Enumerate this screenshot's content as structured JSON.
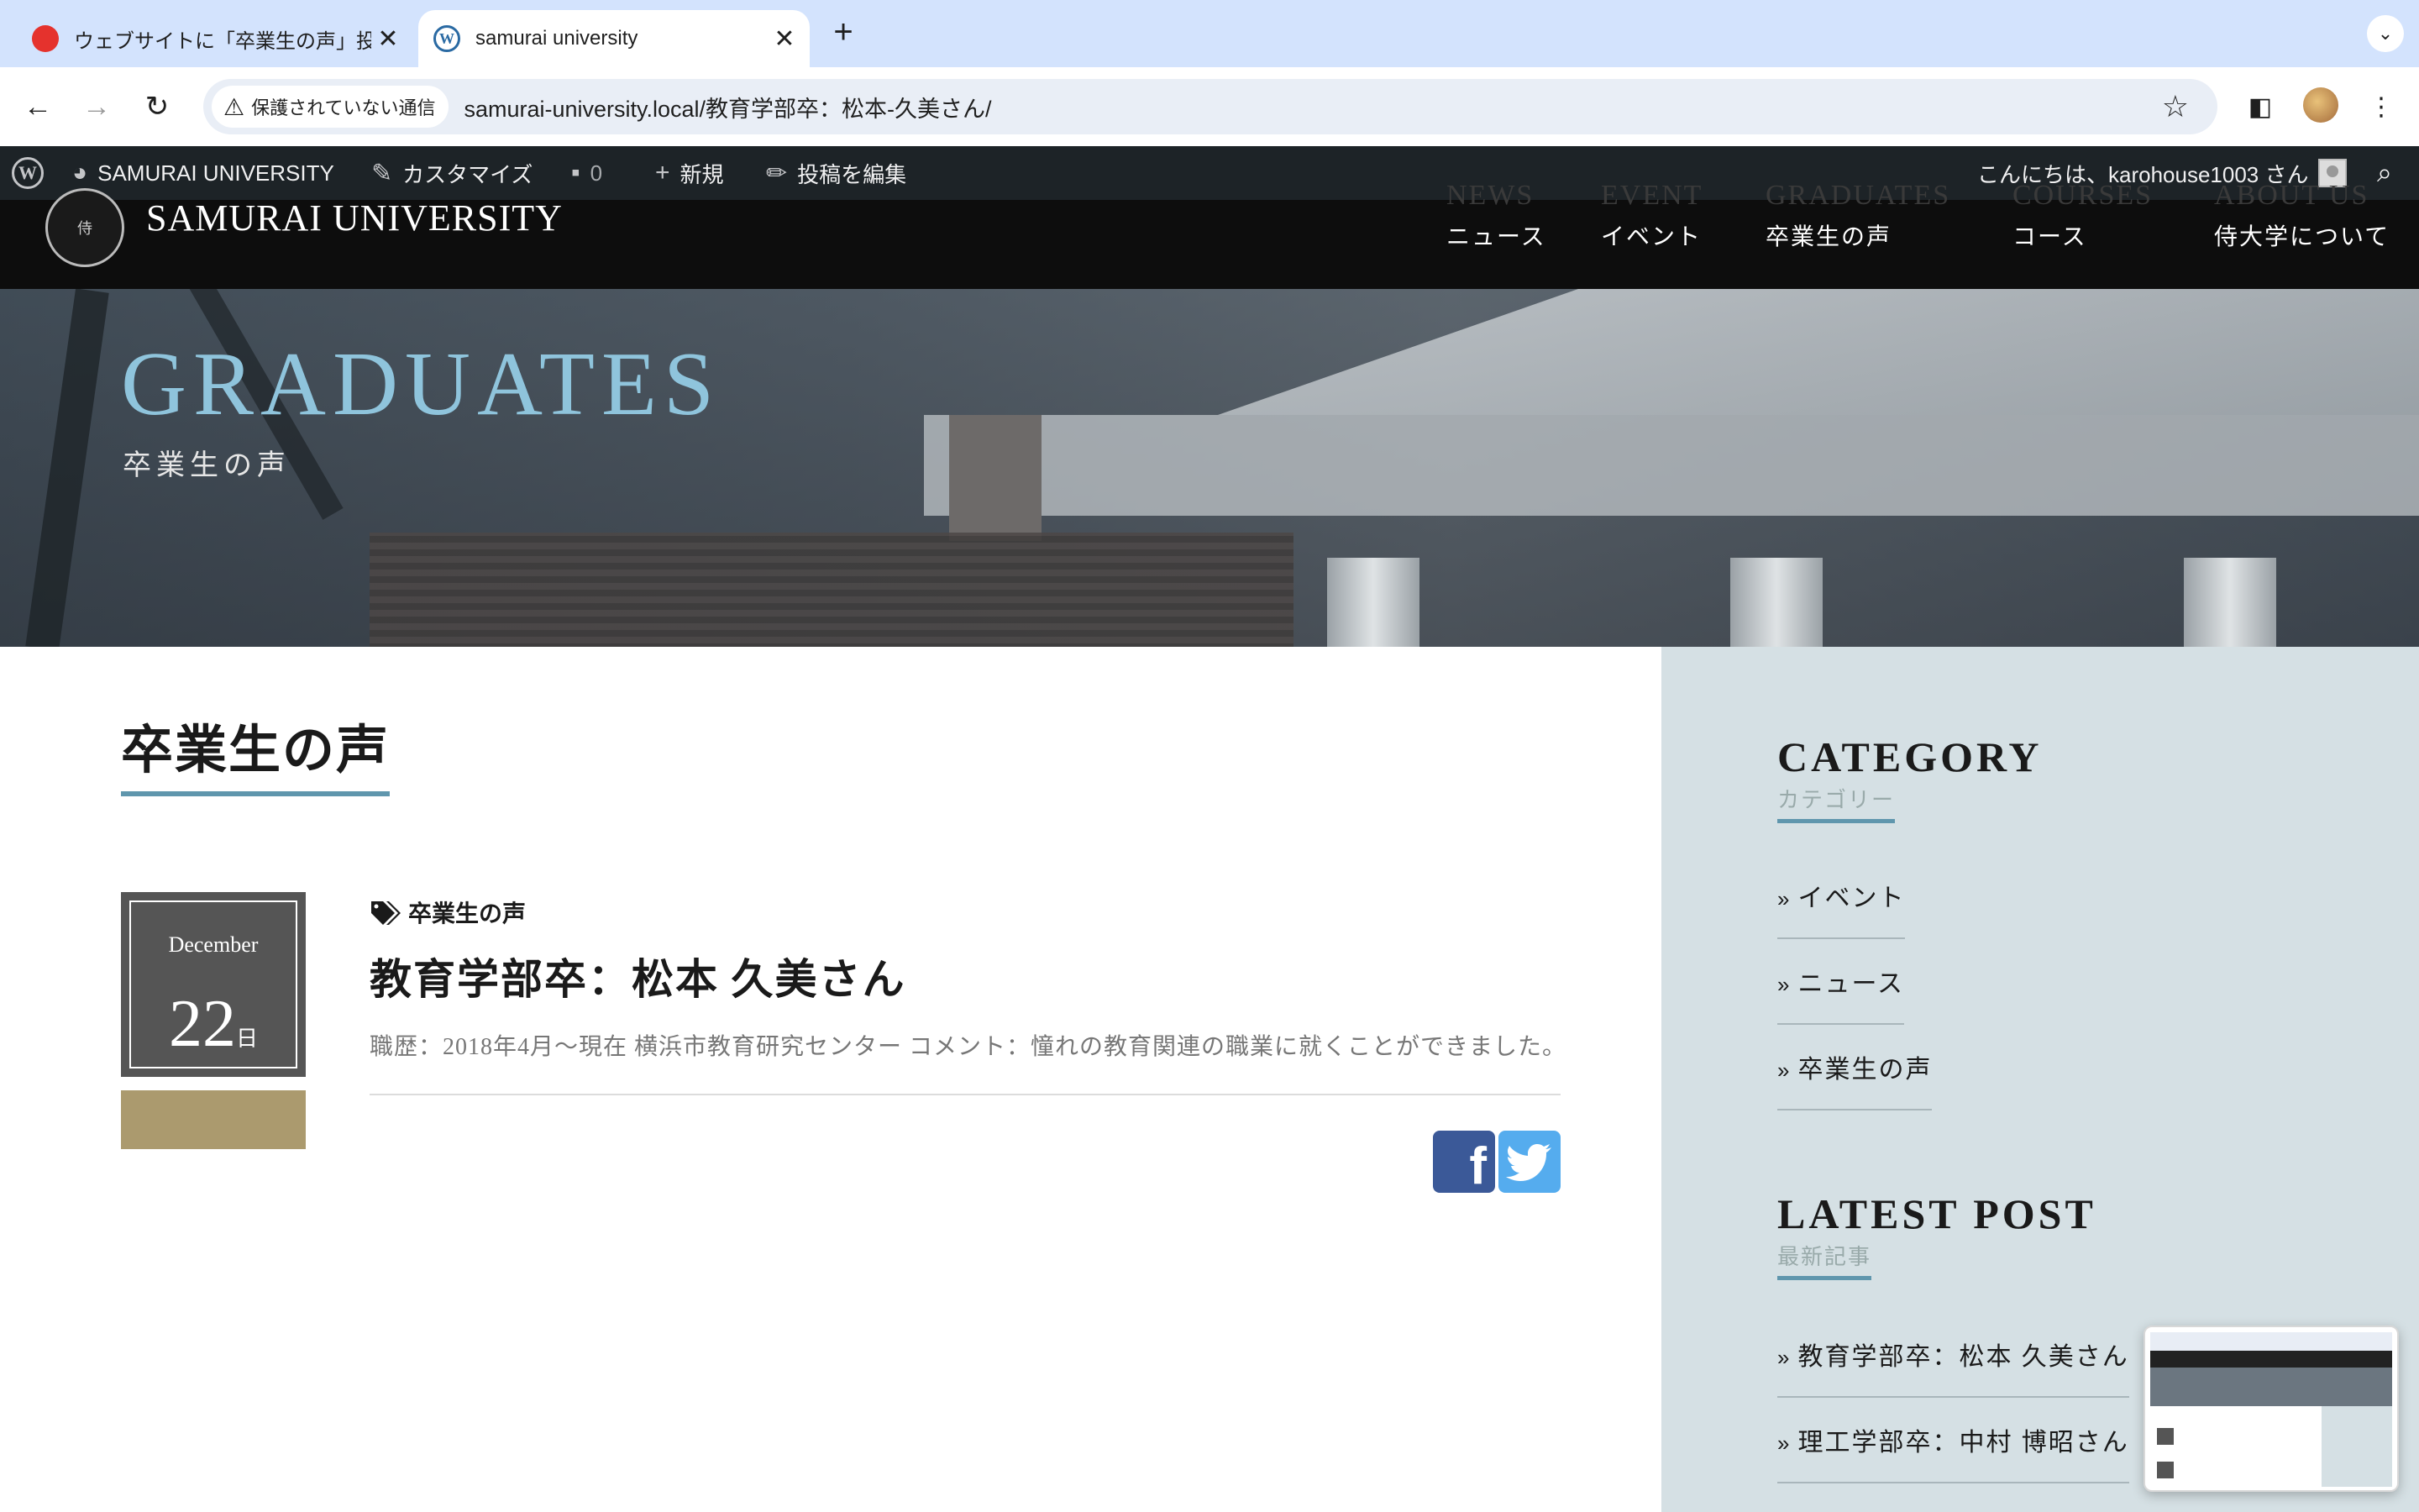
{
  "browser": {
    "tabs": [
      {
        "title": "ウェブサイトに「卒業生の声」投",
        "active": false
      },
      {
        "title": "samurai university",
        "active": true
      }
    ],
    "security_label": "保護されていない通信",
    "url": "samurai-university.local/教育学部卒：松本-久美さん/"
  },
  "adminbar": {
    "site_name": "SAMURAI UNIVERSITY",
    "customize": "カスタマイズ",
    "comments_count": "0",
    "new": "新規",
    "edit_post": "投稿を編集",
    "greeting": "こんにちは、karohouse1003 さん"
  },
  "site": {
    "name": "SAMURAI UNIVERSITY",
    "nav": [
      {
        "en": "NEWS",
        "jp": "ニュース"
      },
      {
        "en": "EVENT",
        "jp": "イベント"
      },
      {
        "en": "GRADUATES",
        "jp": "卒業生の声"
      },
      {
        "en": "COURSES",
        "jp": "コース"
      },
      {
        "en": "ABOUT US",
        "jp": "侍大学について"
      }
    ]
  },
  "hero": {
    "title": "GRADUATES",
    "subtitle": "卒業生の声"
  },
  "main": {
    "heading": "卒業生の声",
    "post": {
      "month": "December",
      "day": "22",
      "day_unit": "日",
      "category": "卒業生の声",
      "title": "教育学部卒：松本 久美さん",
      "excerpt": "職歴：2018年4月～現在 横浜市教育研究センター コメント：憧れの教育関連の職業に就くことができました。"
    }
  },
  "sidebar": {
    "category": {
      "title": "CATEGORY",
      "subtitle": "カテゴリー",
      "items": [
        "イベント",
        "ニュース",
        "卒業生の声"
      ]
    },
    "latest": {
      "title": "LATEST POST",
      "subtitle": "最新記事",
      "items": [
        "教育学部卒：松本 久美さん",
        "理工学部卒：中村 博昭さん"
      ]
    }
  },
  "colors": {
    "accent": "#5f96ad",
    "hero_title": "#8fc4dc",
    "sidebar_bg": "#d5e0e4",
    "category_bar": "#ab9a6e",
    "facebook": "#3b5998",
    "twitter": "#55acee"
  }
}
